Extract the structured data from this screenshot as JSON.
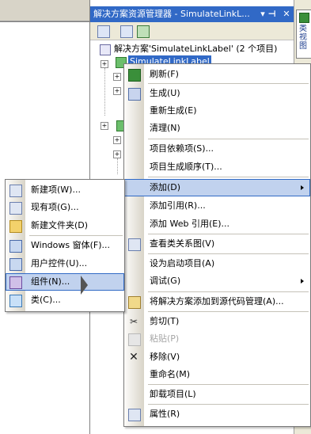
{
  "panel": {
    "title": "解决方案资源管理器 - SimulateLinkL...",
    "pin_glyph": "▾ ⊣",
    "close_glyph": "✕",
    "solution_label": "解决方案'SimulateLinkLabel' (2 个项目)",
    "project_label": "SimulateLinkLabel",
    "tree_plus": "+"
  },
  "right_strip": {
    "tab_label": "类视图"
  },
  "context_menu": {
    "items": [
      {
        "label": "刷新(F)"
      },
      {
        "label": "生成(U)"
      },
      {
        "label": "重新生成(E)"
      },
      {
        "label": "清理(N)"
      },
      {
        "label": "项目依赖项(S)..."
      },
      {
        "label": "项目生成顺序(T)..."
      },
      {
        "label": "添加(D)"
      },
      {
        "label": "添加引用(R)..."
      },
      {
        "label": "添加 Web 引用(E)..."
      },
      {
        "label": "查看类关系图(V)"
      },
      {
        "label": "设为启动项目(A)"
      },
      {
        "label": "调试(G)"
      },
      {
        "label": "将解决方案添加到源代码管理(A)..."
      },
      {
        "label": "剪切(T)"
      },
      {
        "label": "粘贴(P)"
      },
      {
        "label": "移除(V)"
      },
      {
        "label": "重命名(M)"
      },
      {
        "label": "卸载项目(L)"
      },
      {
        "label": "属性(R)"
      }
    ]
  },
  "submenu": {
    "items": [
      {
        "label": "新建项(W)..."
      },
      {
        "label": "现有项(G)..."
      },
      {
        "label": "新建文件夹(D)"
      },
      {
        "label": "Windows 窗体(F)..."
      },
      {
        "label": "用户控件(U)..."
      },
      {
        "label": "组件(N)..."
      },
      {
        "label": "类(C)..."
      }
    ]
  }
}
